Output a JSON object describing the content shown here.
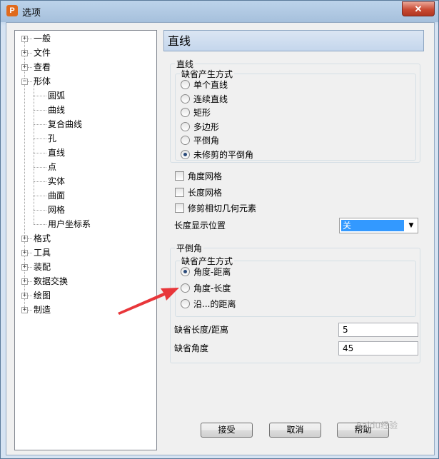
{
  "window": {
    "title": "选项",
    "app_icon_letter": "P",
    "close_glyph": "✕"
  },
  "tree": {
    "expander_collapsed": "+",
    "expander_expanded": "−",
    "top_items": [
      "一般",
      "文件",
      "查看",
      "形体"
    ],
    "shape_children": [
      "圆弧",
      "曲线",
      "复合曲线",
      "孔",
      "直线",
      "点",
      "实体",
      "曲面",
      "网格",
      "用户坐标系"
    ],
    "bottom_items": [
      "格式",
      "工具",
      "装配",
      "数据交换",
      "绘图",
      "制造"
    ]
  },
  "panel": {
    "title": "直线",
    "line_group": {
      "label": "直线",
      "default_mode": {
        "label": "缺省产生方式",
        "options": [
          "单个直线",
          "连续直线",
          "矩形",
          "多边形",
          "平倒角",
          "未修剪的平倒角"
        ],
        "selected_index": 5
      }
    },
    "checkboxes": [
      "角度网格",
      "长度网格",
      "修剪相切几何元素"
    ],
    "length_display": {
      "label": "长度显示位置",
      "value": "关"
    },
    "chamfer_group": {
      "label": "平倒角",
      "default_mode": {
        "label": "缺省产生方式",
        "options": [
          "角度-距离",
          "角度-长度",
          "沿...的距离"
        ],
        "selected_index": 0
      },
      "default_length": {
        "label": "缺省长度/距离",
        "value": "5"
      },
      "default_angle": {
        "label": "缺省角度",
        "value": "45"
      }
    }
  },
  "buttons": {
    "ok": "接受",
    "cancel": "取消",
    "help": "帮助"
  },
  "watermark": "Baidu经验",
  "annotation_arrow_color": "#e8363a"
}
